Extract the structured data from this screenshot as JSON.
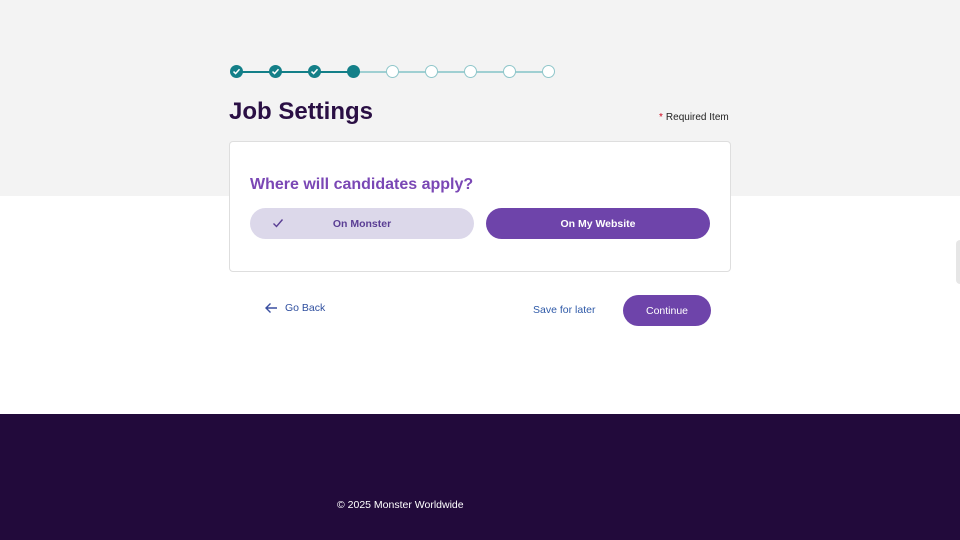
{
  "stepper": {
    "total_steps": 9,
    "completed_steps": 3,
    "current_step": 4
  },
  "page": {
    "title": "Job Settings",
    "required_marker": "*",
    "required_label": "Required Item"
  },
  "question_card": {
    "question": "Where will candidates apply?",
    "options": [
      {
        "label": "On Monster",
        "selected": true
      },
      {
        "label": "On My Website",
        "selected": false
      }
    ]
  },
  "actions": {
    "go_back": "Go Back",
    "save_for_later": "Save for later",
    "continue": "Continue"
  },
  "footer": {
    "copyright": "© 2025 Monster Worldwide"
  },
  "colors": {
    "brand_purple": "#6e44aa",
    "teal_progress": "#137f88",
    "footer_bg": "#220a3b",
    "title_color": "#2a0f44"
  }
}
